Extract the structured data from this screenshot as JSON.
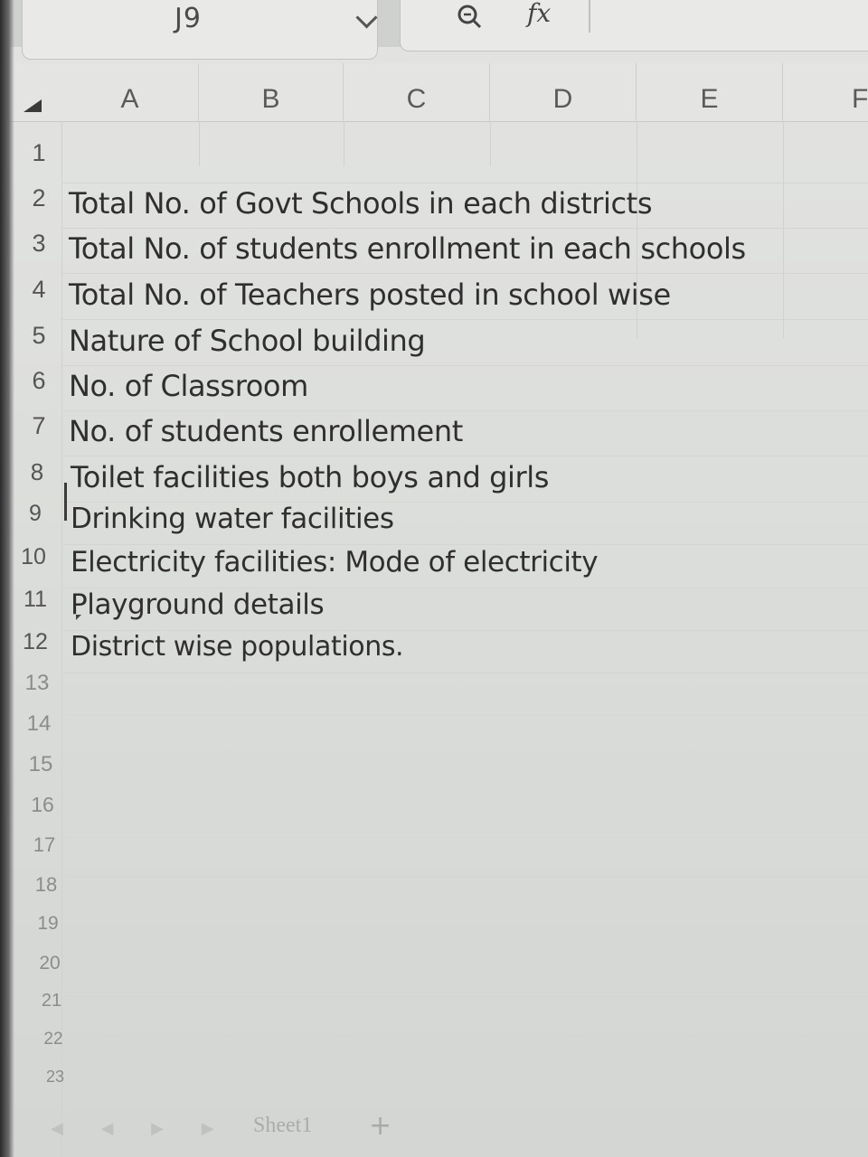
{
  "formula_bar": {
    "name_box": "J9",
    "fx_label": "fx"
  },
  "columns": [
    "A",
    "B",
    "C",
    "D",
    "E",
    "F"
  ],
  "rows": [
    {
      "num": "1",
      "text": ""
    },
    {
      "num": "2",
      "text": "Total No. of Govt Schools in each districts"
    },
    {
      "num": "3",
      "text": "Total No. of students enrollment in each schools"
    },
    {
      "num": "4",
      "text": "Total No. of Teachers posted in school wise"
    },
    {
      "num": "5",
      "text": "Nature of School building"
    },
    {
      "num": "6",
      "text": "No. of Classroom"
    },
    {
      "num": "7",
      "text": "No. of students enrollement"
    },
    {
      "num": "8",
      "text": "Toilet facilities both boys and girls"
    },
    {
      "num": "9",
      "text": "Drinking water facilities"
    },
    {
      "num": "10",
      "text": "Electricity facilities: Mode of electricity"
    },
    {
      "num": "11",
      "text": "Playground details"
    },
    {
      "num": "12",
      "text": "District wise populations."
    },
    {
      "num": "13",
      "text": ""
    },
    {
      "num": "14",
      "text": ""
    },
    {
      "num": "15",
      "text": ""
    },
    {
      "num": "16",
      "text": ""
    },
    {
      "num": "17",
      "text": ""
    },
    {
      "num": "18",
      "text": ""
    },
    {
      "num": "19",
      "text": ""
    },
    {
      "num": "20",
      "text": ""
    },
    {
      "num": "21",
      "text": ""
    },
    {
      "num": "22",
      "text": ""
    },
    {
      "num": "23",
      "text": ""
    }
  ],
  "sheet_tabs": {
    "active": "Sheet1",
    "add_label": "+"
  }
}
